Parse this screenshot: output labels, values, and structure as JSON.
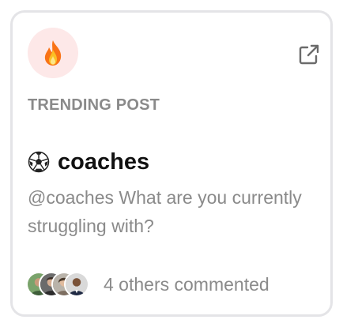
{
  "card": {
    "icon": "fire-icon",
    "external_link_icon": "external-link-icon",
    "eyebrow": "TRENDING POST",
    "title_icon": "soccer-ball-icon",
    "title": "coaches",
    "body": "@coaches What are you currently struggling with?",
    "footer": {
      "avatars": [
        "avatar-1",
        "avatar-2",
        "avatar-3",
        "avatar-4"
      ],
      "text": "4 others commented"
    }
  },
  "colors": {
    "badge_bg": "#fde8e8",
    "flame": "#f97316",
    "muted_text": "#8a8a8a",
    "title_text": "#111111",
    "border": "#e4e4e7"
  }
}
